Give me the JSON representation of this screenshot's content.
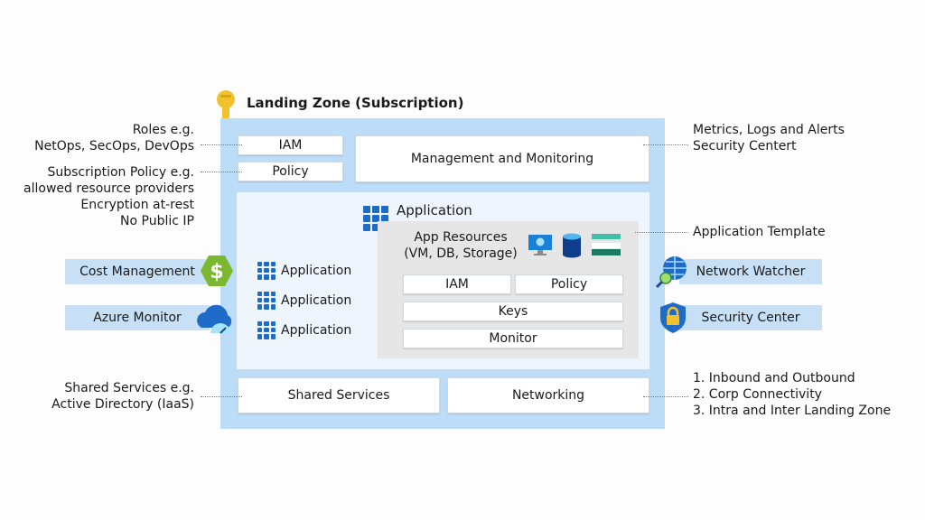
{
  "title": "Landing Zone (Subscription)",
  "left_annotations": {
    "roles": [
      "Roles e.g.",
      "NetOps, SecOps, DevOps"
    ],
    "policy": [
      "Subscription Policy e.g.",
      "allowed resource providers",
      "Encryption at-rest",
      "No Public IP"
    ],
    "shared": [
      "Shared Services e.g.",
      "Active Directory (IaaS)"
    ]
  },
  "right_annotations": {
    "management": [
      "Metrics, Logs and Alerts",
      "Security Centert"
    ],
    "template": "Application Template",
    "networking": [
      "1. Inbound and Outbound",
      "2. Corp Connectivity",
      "3. Intra and Inter Landing Zone"
    ]
  },
  "boxes": {
    "iam": "IAM",
    "policy": "Policy",
    "management": "Management and Monitoring",
    "shared_services": "Shared Services",
    "networking": "Networking"
  },
  "application_block": {
    "header": "Application",
    "resources_line1": "App Resources",
    "resources_line2": "(VM, DB, Storage)",
    "iam": "IAM",
    "policy": "Policy",
    "keys": "Keys",
    "monitor": "Monitor",
    "resource_icons": [
      "virtual-machine-icon",
      "database-icon",
      "storage-icon"
    ]
  },
  "applications": [
    "Application",
    "Application",
    "Application"
  ],
  "left_services": [
    {
      "label": "Cost Management",
      "icon": "cost-management-icon"
    },
    {
      "label": "Azure Monitor",
      "icon": "azure-monitor-icon"
    }
  ],
  "right_services": [
    {
      "label": "Network Watcher",
      "icon": "network-watcher-icon"
    },
    {
      "label": "Security Center",
      "icon": "security-center-icon"
    }
  ],
  "colors": {
    "zone_fill": "#bcdcf7",
    "inner_fill": "#eef5fd",
    "accent_blue": "#1e6cc7",
    "key_yellow": "#f2c12e",
    "cost_green": "#7cb82f"
  }
}
